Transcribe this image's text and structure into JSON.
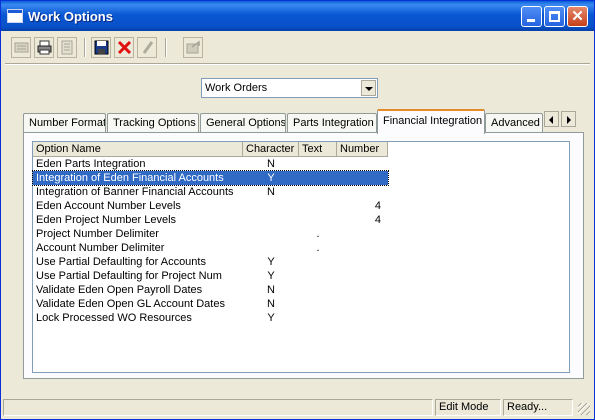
{
  "window": {
    "title": "Work Options",
    "controls": [
      "minimize",
      "maximize",
      "close"
    ]
  },
  "toolbar": {
    "buttons": [
      {
        "icon": "new-record-icon",
        "enabled": false
      },
      {
        "icon": "print-icon",
        "enabled": true
      },
      {
        "icon": "print-preview-icon",
        "enabled": false
      },
      {
        "icon": "save-icon",
        "enabled": true
      },
      {
        "icon": "delete-icon",
        "enabled": true,
        "color": "#e01010"
      },
      {
        "icon": "edit-icon",
        "enabled": false
      },
      {
        "icon": "export-icon",
        "enabled": false
      }
    ]
  },
  "selector": {
    "value": "Work Orders"
  },
  "tabs": [
    {
      "label": "Number Format",
      "active": false
    },
    {
      "label": "Tracking Options",
      "active": false
    },
    {
      "label": "General Options",
      "active": false
    },
    {
      "label": "Parts Integration",
      "active": false
    },
    {
      "label": "Financial Integration",
      "active": true
    },
    {
      "label": "Advanced (",
      "active": false
    }
  ],
  "grid": {
    "columns": [
      "Option Name",
      "Character",
      "Text",
      "Number"
    ],
    "rows": [
      {
        "name": "Eden Parts Integration",
        "character": "N",
        "text": "",
        "number": ""
      },
      {
        "name": "Integration of Eden Financial Accounts",
        "character": "Y",
        "text": "",
        "number": "",
        "selected": true
      },
      {
        "name": "Integration of Banner Financial Accounts",
        "character": "N",
        "text": "",
        "number": ""
      },
      {
        "name": "Eden Account Number Levels",
        "character": "",
        "text": "",
        "number": "4"
      },
      {
        "name": "Eden Project Number Levels",
        "character": "",
        "text": "",
        "number": "4"
      },
      {
        "name": "Project Number Delimiter",
        "character": "",
        "text": ".",
        "number": ""
      },
      {
        "name": "Account Number Delimiter",
        "character": "",
        "text": ".",
        "number": ""
      },
      {
        "name": "Use Partial Defaulting for Accounts",
        "character": "Y",
        "text": "",
        "number": ""
      },
      {
        "name": "Use Partial Defaulting for Project Num",
        "character": "Y",
        "text": "",
        "number": ""
      },
      {
        "name": "Validate Eden Open Payroll Dates",
        "character": "N",
        "text": "",
        "number": ""
      },
      {
        "name": "Validate Eden Open GL Account Dates",
        "character": "N",
        "text": "",
        "number": ""
      },
      {
        "name": "Lock Processed WO Resources",
        "character": "Y",
        "text": "",
        "number": ""
      }
    ]
  },
  "status": {
    "mode": "Edit Mode",
    "message": "Ready..."
  },
  "colors": {
    "titlebar": "#0a58d4",
    "selection": "#316ac5",
    "active_tab_accent": "#e68b2c",
    "face": "#ece9d8"
  }
}
